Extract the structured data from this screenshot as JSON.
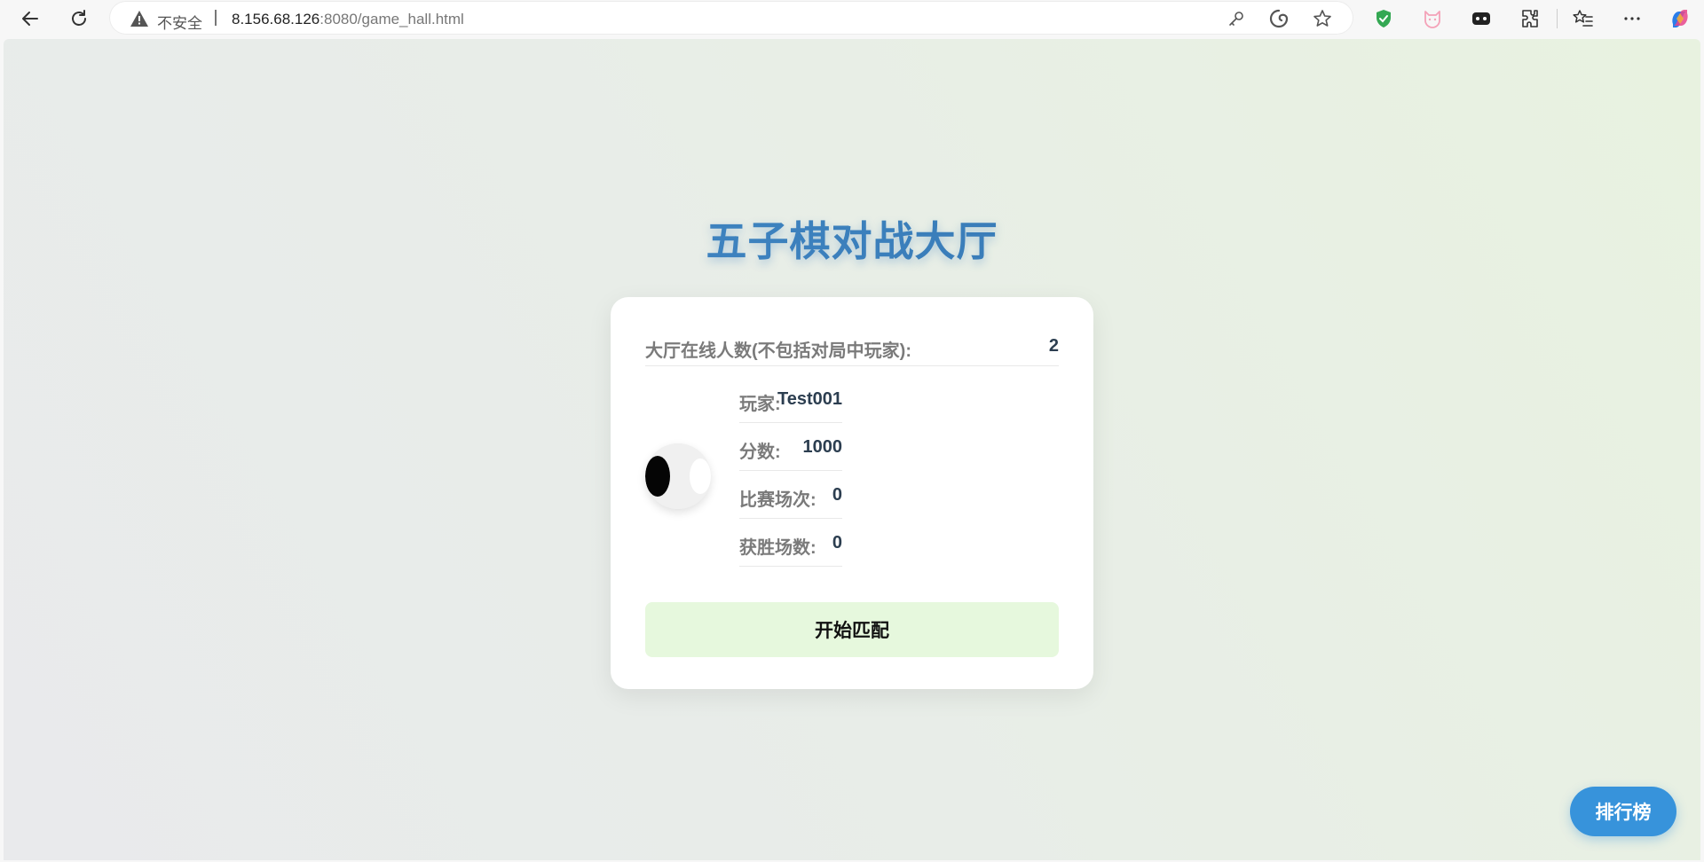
{
  "browser": {
    "security_label": "不安全",
    "url_host": "8.156.68.126",
    "url_rest": ":8080/game_hall.html"
  },
  "page": {
    "title": "五子棋对战大厅",
    "online": {
      "label": "大厅在线人数(不包括对局中玩家):",
      "count": "2"
    },
    "player": {
      "name_label": "玩家:",
      "name": "Test001",
      "score_label": "分数:",
      "score": "1000",
      "matches_label": "比赛场次:",
      "matches": "0",
      "wins_label": "获胜场数:",
      "wins": "0"
    },
    "match_button": "开始匹配",
    "rank_button": "排行榜"
  },
  "colors": {
    "title": "#3a7fc0",
    "match_button_bg": "#e6f8dd",
    "rank_button_bg": "#3793db"
  }
}
